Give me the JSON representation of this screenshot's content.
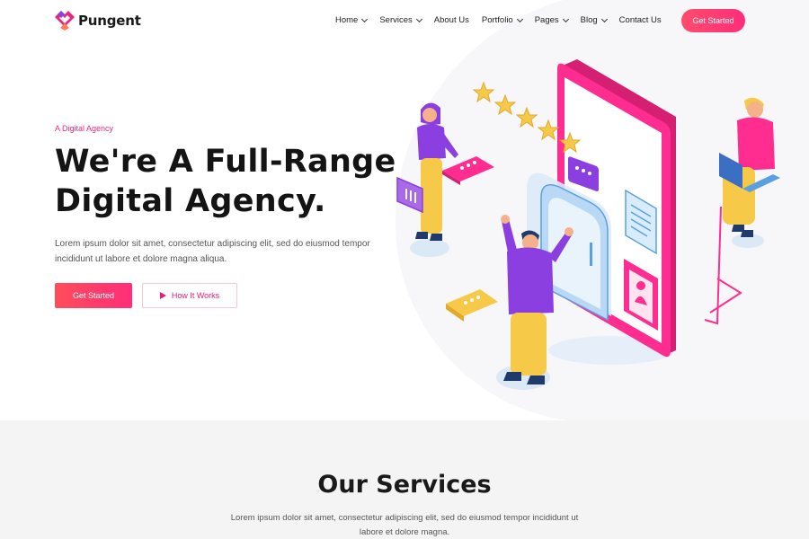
{
  "brand": {
    "name": "Pungent"
  },
  "nav": {
    "items": [
      {
        "label": "Home",
        "dropdown": true
      },
      {
        "label": "Services",
        "dropdown": true
      },
      {
        "label": "About Us",
        "dropdown": false
      },
      {
        "label": "Portfolio",
        "dropdown": true
      },
      {
        "label": "Pages",
        "dropdown": true
      },
      {
        "label": "Blog",
        "dropdown": true
      },
      {
        "label": "Contact Us",
        "dropdown": false
      }
    ],
    "cta_label": "Get Started"
  },
  "hero": {
    "eyebrow": "A Digital Agency",
    "title_line1": "We're A Full-Range",
    "title_line2": "Digital Agency.",
    "description": "Lorem ipsum dolor sit amet, consectetur adipiscing elit, sed do eiusmod tempor incididunt ut labore et dolore magna aliqua.",
    "primary_button": "Get Started",
    "secondary_button": "How It Works"
  },
  "services": {
    "title": "Our Services",
    "description": "Lorem ipsum dolor sit amet, consectetur adipiscing elit, sed do eiusmod tempor incididunt ut labore et dolore magna."
  },
  "colors": {
    "accent": "#ff2d7a",
    "accent_start": "#ff4d5a",
    "purple": "#8b3fe0",
    "yellow": "#f7c948"
  }
}
